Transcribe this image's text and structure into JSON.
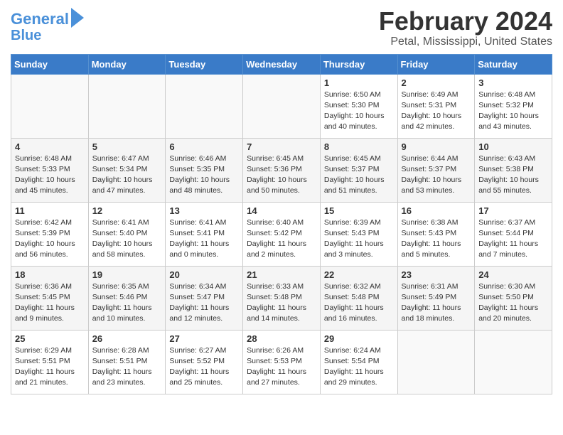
{
  "header": {
    "logo_line1": "General",
    "logo_line2": "Blue",
    "title": "February 2024",
    "subtitle": "Petal, Mississippi, United States"
  },
  "days_of_week": [
    "Sunday",
    "Monday",
    "Tuesday",
    "Wednesday",
    "Thursday",
    "Friday",
    "Saturday"
  ],
  "weeks": [
    [
      {
        "num": "",
        "info": ""
      },
      {
        "num": "",
        "info": ""
      },
      {
        "num": "",
        "info": ""
      },
      {
        "num": "",
        "info": ""
      },
      {
        "num": "1",
        "info": "Sunrise: 6:50 AM\nSunset: 5:30 PM\nDaylight: 10 hours\nand 40 minutes."
      },
      {
        "num": "2",
        "info": "Sunrise: 6:49 AM\nSunset: 5:31 PM\nDaylight: 10 hours\nand 42 minutes."
      },
      {
        "num": "3",
        "info": "Sunrise: 6:48 AM\nSunset: 5:32 PM\nDaylight: 10 hours\nand 43 minutes."
      }
    ],
    [
      {
        "num": "4",
        "info": "Sunrise: 6:48 AM\nSunset: 5:33 PM\nDaylight: 10 hours\nand 45 minutes."
      },
      {
        "num": "5",
        "info": "Sunrise: 6:47 AM\nSunset: 5:34 PM\nDaylight: 10 hours\nand 47 minutes."
      },
      {
        "num": "6",
        "info": "Sunrise: 6:46 AM\nSunset: 5:35 PM\nDaylight: 10 hours\nand 48 minutes."
      },
      {
        "num": "7",
        "info": "Sunrise: 6:45 AM\nSunset: 5:36 PM\nDaylight: 10 hours\nand 50 minutes."
      },
      {
        "num": "8",
        "info": "Sunrise: 6:45 AM\nSunset: 5:37 PM\nDaylight: 10 hours\nand 51 minutes."
      },
      {
        "num": "9",
        "info": "Sunrise: 6:44 AM\nSunset: 5:37 PM\nDaylight: 10 hours\nand 53 minutes."
      },
      {
        "num": "10",
        "info": "Sunrise: 6:43 AM\nSunset: 5:38 PM\nDaylight: 10 hours\nand 55 minutes."
      }
    ],
    [
      {
        "num": "11",
        "info": "Sunrise: 6:42 AM\nSunset: 5:39 PM\nDaylight: 10 hours\nand 56 minutes."
      },
      {
        "num": "12",
        "info": "Sunrise: 6:41 AM\nSunset: 5:40 PM\nDaylight: 10 hours\nand 58 minutes."
      },
      {
        "num": "13",
        "info": "Sunrise: 6:41 AM\nSunset: 5:41 PM\nDaylight: 11 hours\nand 0 minutes."
      },
      {
        "num": "14",
        "info": "Sunrise: 6:40 AM\nSunset: 5:42 PM\nDaylight: 11 hours\nand 2 minutes."
      },
      {
        "num": "15",
        "info": "Sunrise: 6:39 AM\nSunset: 5:43 PM\nDaylight: 11 hours\nand 3 minutes."
      },
      {
        "num": "16",
        "info": "Sunrise: 6:38 AM\nSunset: 5:43 PM\nDaylight: 11 hours\nand 5 minutes."
      },
      {
        "num": "17",
        "info": "Sunrise: 6:37 AM\nSunset: 5:44 PM\nDaylight: 11 hours\nand 7 minutes."
      }
    ],
    [
      {
        "num": "18",
        "info": "Sunrise: 6:36 AM\nSunset: 5:45 PM\nDaylight: 11 hours\nand 9 minutes."
      },
      {
        "num": "19",
        "info": "Sunrise: 6:35 AM\nSunset: 5:46 PM\nDaylight: 11 hours\nand 10 minutes."
      },
      {
        "num": "20",
        "info": "Sunrise: 6:34 AM\nSunset: 5:47 PM\nDaylight: 11 hours\nand 12 minutes."
      },
      {
        "num": "21",
        "info": "Sunrise: 6:33 AM\nSunset: 5:48 PM\nDaylight: 11 hours\nand 14 minutes."
      },
      {
        "num": "22",
        "info": "Sunrise: 6:32 AM\nSunset: 5:48 PM\nDaylight: 11 hours\nand 16 minutes."
      },
      {
        "num": "23",
        "info": "Sunrise: 6:31 AM\nSunset: 5:49 PM\nDaylight: 11 hours\nand 18 minutes."
      },
      {
        "num": "24",
        "info": "Sunrise: 6:30 AM\nSunset: 5:50 PM\nDaylight: 11 hours\nand 20 minutes."
      }
    ],
    [
      {
        "num": "25",
        "info": "Sunrise: 6:29 AM\nSunset: 5:51 PM\nDaylight: 11 hours\nand 21 minutes."
      },
      {
        "num": "26",
        "info": "Sunrise: 6:28 AM\nSunset: 5:51 PM\nDaylight: 11 hours\nand 23 minutes."
      },
      {
        "num": "27",
        "info": "Sunrise: 6:27 AM\nSunset: 5:52 PM\nDaylight: 11 hours\nand 25 minutes."
      },
      {
        "num": "28",
        "info": "Sunrise: 6:26 AM\nSunset: 5:53 PM\nDaylight: 11 hours\nand 27 minutes."
      },
      {
        "num": "29",
        "info": "Sunrise: 6:24 AM\nSunset: 5:54 PM\nDaylight: 11 hours\nand 29 minutes."
      },
      {
        "num": "",
        "info": ""
      },
      {
        "num": "",
        "info": ""
      }
    ]
  ]
}
